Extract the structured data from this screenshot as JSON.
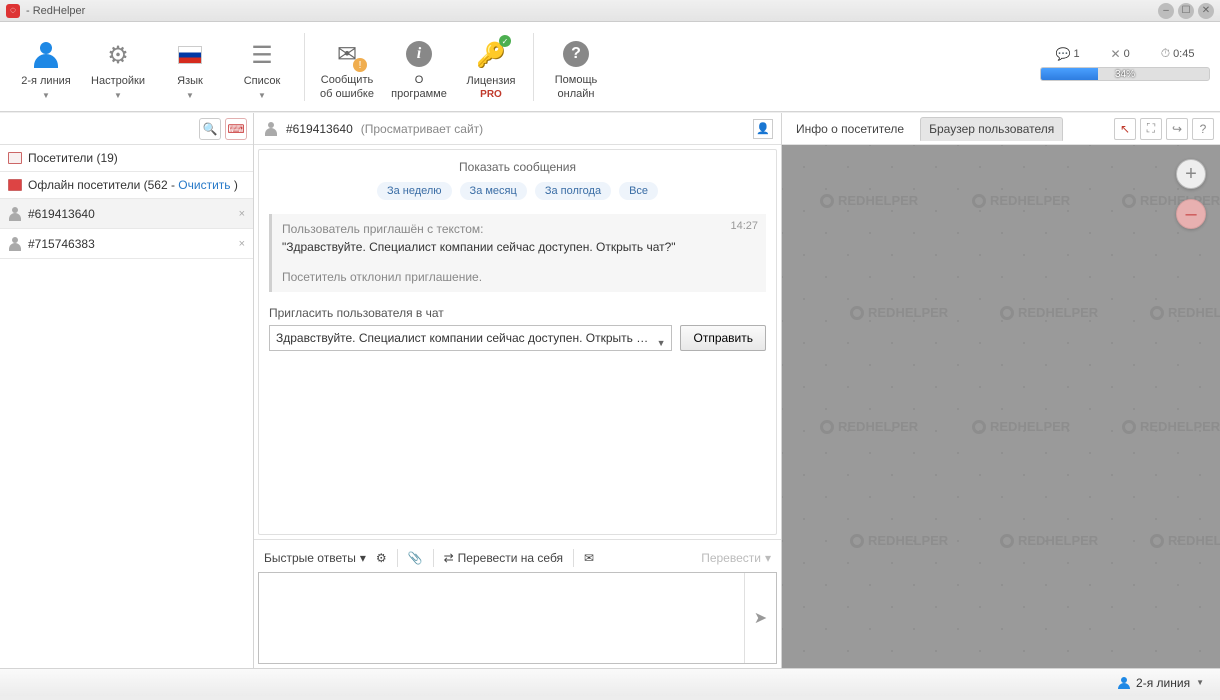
{
  "window": {
    "title": " - RedHelper"
  },
  "toolbar": {
    "second_line": "2-я линия",
    "settings": "Настройки",
    "language": "Язык",
    "list": "Список",
    "report_error": "Сообщить\nоб ошибке",
    "about": "О\nпрограмме",
    "license": "Лицензия",
    "license_sub": "PRO",
    "help_online": "Помощь\nонлайн"
  },
  "topright": {
    "chat_count": "1",
    "x_count": "0",
    "timer": "0:45",
    "progress_pct": "34%",
    "progress_val": 34
  },
  "sidebar": {
    "visitors_label": "Посетители (19)",
    "offline_label": "Офлайн посетители (562 - ",
    "offline_clear": "Очистить",
    "offline_close": " )",
    "items": [
      {
        "id": "#619413640"
      },
      {
        "id": "#715746383"
      }
    ]
  },
  "chat": {
    "visitor_id": "#619413640",
    "visitor_status": "(Просматривает сайт)",
    "show_messages": "Показать сообщения",
    "ranges": [
      "За неделю",
      "За месяц",
      "За полгода",
      "Все"
    ],
    "event_time": "14:27",
    "event_line1": "Пользователь приглашён с текстом:",
    "event_quote": "\"Здравствуйте. Специалист компании сейчас доступен. Открыть чат?\"",
    "event_declined": "Посетитель отклонил приглашение.",
    "invite_label": "Пригласить пользователя в чат",
    "invite_value": "Здравствуйте. Специалист компании сейчас доступен. Открыть чат?",
    "send": "Отправить"
  },
  "compose": {
    "quick": "Быстрые ответы",
    "take": "Перевести на себя",
    "translate": "Перевести"
  },
  "right": {
    "tab_info": "Инфо о посетителе",
    "tab_browser": "Браузер пользователя",
    "brand": "REDHELPER"
  },
  "status": {
    "line": "2-я линия"
  }
}
